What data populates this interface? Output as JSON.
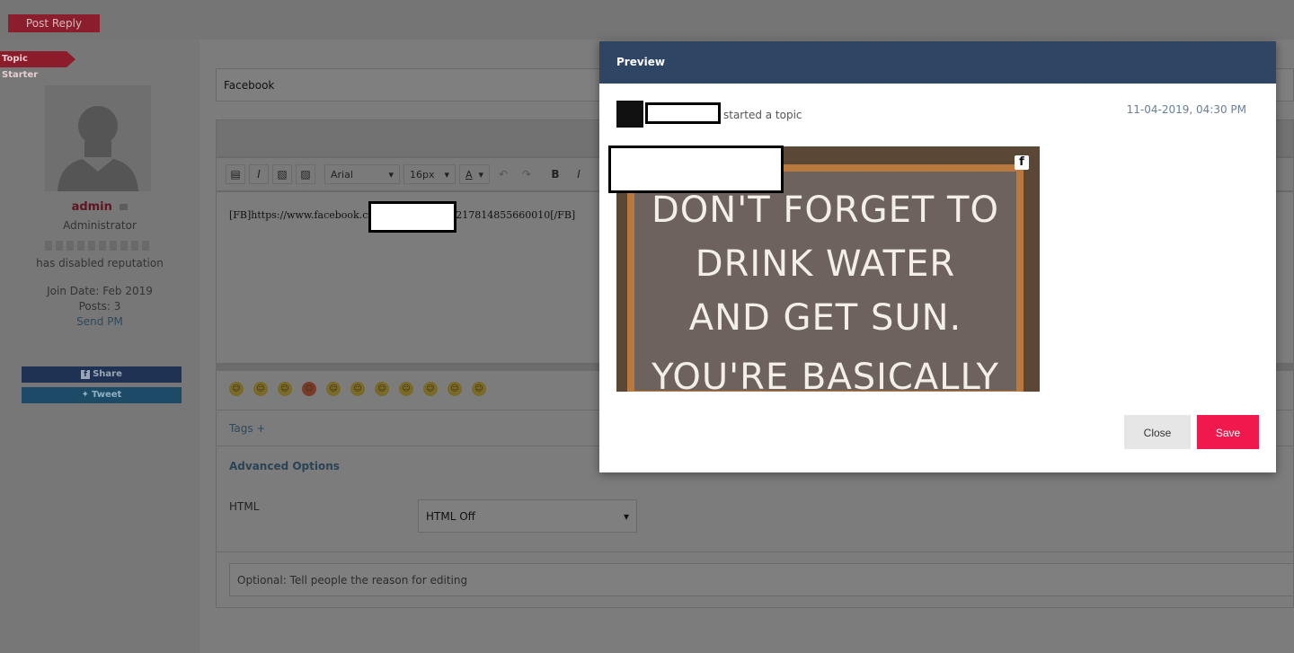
{
  "page": {
    "post_reply_label": "Post Reply",
    "topic_starter_label": "Topic Starter",
    "title_value": "Facebook",
    "editor": {
      "font": "Arial",
      "size": "16px",
      "content": "[FB]https://www.facebook.com/                  posts/10217814855660010[/FB]",
      "content_part1": "[FB]https://www.facebook.com/",
      "content_part2": "posts/10217814855660010[/FB]"
    },
    "tags_label": "Tags +",
    "advanced_options_label": "Advanced Options",
    "html_label": "HTML",
    "html_selected": "HTML Off",
    "reason_placeholder": "Optional: Tell people the reason for editing"
  },
  "user": {
    "username": "admin",
    "role": "Administrator",
    "reputation_text": "has disabled reputation",
    "join_date": "Join Date: Feb 2019",
    "posts": "Posts: 3",
    "send_pm": "Send PM",
    "share_label": "Share",
    "tweet_label": "Tweet"
  },
  "modal": {
    "title": "Preview",
    "started_text": "started a topic",
    "date": "11-04-2019, 04:30 PM",
    "embed_lines": [
      "DON'T FORGET TO",
      "DRINK WATER",
      "AND GET SUN.",
      "YOU'RE BASICALLY"
    ],
    "close_label": "Close",
    "save_label": "Save"
  },
  "colors": {
    "modal_header": "#2e4564",
    "save_button": "#f0194d",
    "close_button": "#e6e6e6",
    "brand_red": "#c8283c"
  }
}
